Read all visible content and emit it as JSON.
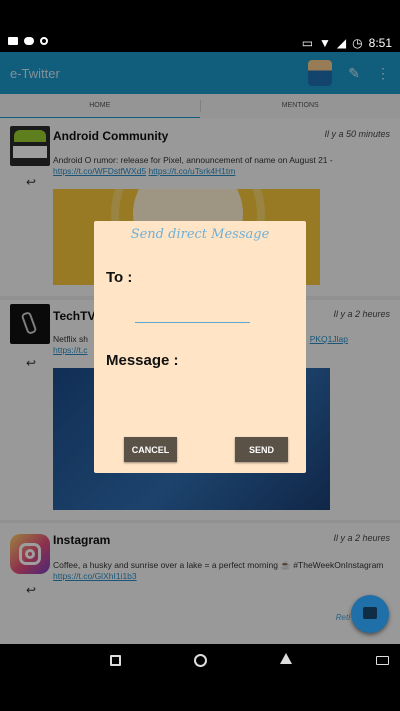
{
  "status_bar": {
    "time": "8:51",
    "left_icons": [
      "camera-icon",
      "cloud-icon",
      "record-icon"
    ],
    "right_icons": [
      "cast-icon",
      "wifi-icon",
      "signal-icon",
      "alarm-icon"
    ]
  },
  "app": {
    "title": "e-Twitter"
  },
  "tabs": [
    {
      "label": "HOME",
      "active": true
    },
    {
      "label": "MENTIONS",
      "active": false
    }
  ],
  "tweets": [
    {
      "name": "Android Community",
      "time": "Il y a 50 minutes",
      "text": "Android O rumor: release for Pixel, announcement of name on August 21 -",
      "links": [
        "https://t.co/WFDstfWXd5",
        "https://t.co/uTsrk4H1tm"
      ]
    },
    {
      "name": "TechTV",
      "time": "Il y a 2 heures",
      "text": "Netflix sh",
      "link_start": "https://t.c",
      "link_end": "PKQ1Jlap"
    },
    {
      "name": "Instagram",
      "time": "Il y a 2 heures",
      "text": "Coffee, a husky and sunrise over a lake = a perfect morning ☕ #TheWeekOnInstagram",
      "link": "https://t.co/GlXhI1i1b3",
      "retweet": "Reti"
    }
  ],
  "dialog": {
    "title": "Send direct Message",
    "to_label": "To :",
    "to_value": "",
    "message_label": "Message :",
    "cancel_label": "CANCEL",
    "send_label": "SEND"
  },
  "colors": {
    "app_bar": "#1c96c8",
    "dialog_bg": "#ffe4c6",
    "button_bg": "#5a5147",
    "fab": "#1f6fa8"
  }
}
